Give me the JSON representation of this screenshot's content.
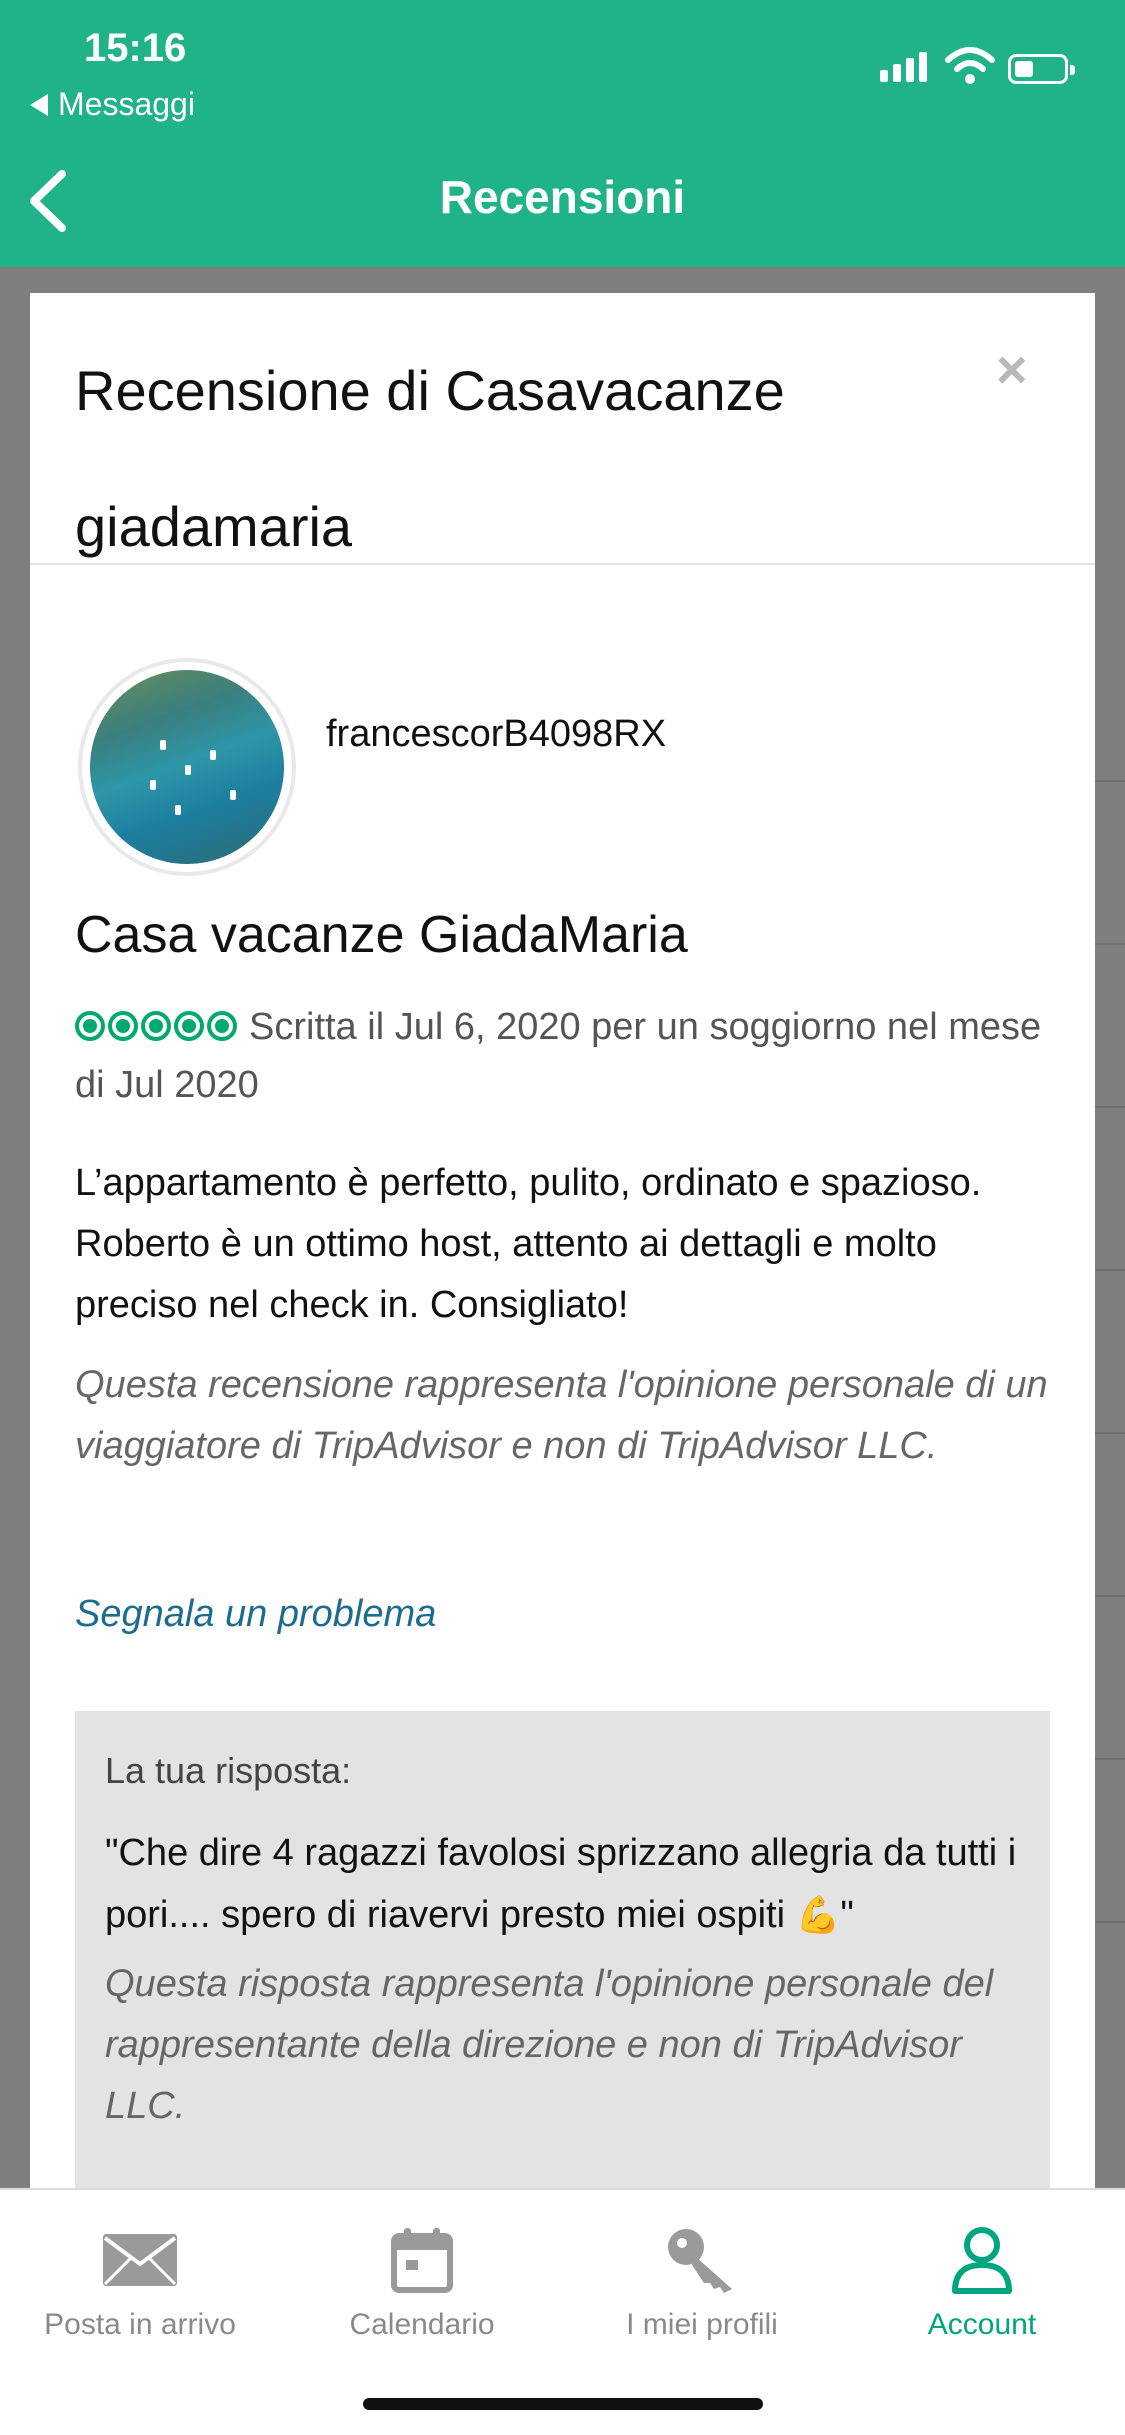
{
  "status_bar": {
    "time": "15:16",
    "back_app": "Messaggi"
  },
  "header": {
    "title": "Recensioni"
  },
  "modal": {
    "title": "Recensione di Casavacanze giadamaria",
    "close_glyph": "×"
  },
  "review": {
    "username": "francescorB4098RX",
    "place": "Casa vacanze GiadaMaria",
    "rating": 5,
    "meta": "Scritta il Jul 6, 2020 per un soggiorno nel mese di Jul 2020",
    "text": "L’appartamento è perfetto, pulito, ordinato e spazioso. Roberto è un ottimo host, attento ai dettagli e molto preciso nel check in. Consigliato!",
    "disclaimer": "Questa recensione rappresenta l'opinione personale di un viaggiatore di TripAdvisor e non di TripAdvisor LLC.",
    "report_link": "Segnala un problema"
  },
  "response": {
    "label": "La tua risposta:",
    "text_open": "\"Che dire 4 ragazzi favolosi sprizzano allegria da tutti i pori.... spero di riavervi presto miei ospiti",
    "emoji": "💪",
    "text_close": "\"",
    "disclaimer": "Questa risposta rappresenta l'opinione personale del rappresentante della direzione e non di TripAdvisor LLC."
  },
  "tabbar": {
    "items": [
      {
        "label": "Posta in arrivo",
        "icon": "envelope-icon"
      },
      {
        "label": "Calendario",
        "icon": "calendar-icon"
      },
      {
        "label": "I miei profili",
        "icon": "key-icon"
      },
      {
        "label": "Account",
        "icon": "person-icon",
        "active": true
      }
    ]
  },
  "colors": {
    "brand_green": "#20b389",
    "active_tab": "#00a680",
    "link": "#1b6c8f",
    "bubble": "#00aa6c"
  }
}
